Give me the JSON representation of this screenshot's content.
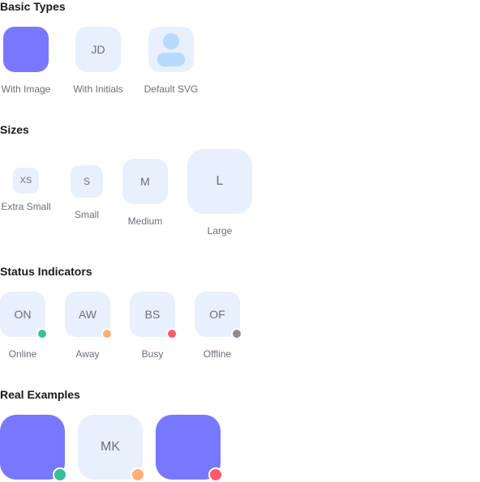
{
  "sections": {
    "basic": {
      "title": "Basic Types",
      "items": [
        {
          "label": "With Image"
        },
        {
          "label": "With Initials",
          "initials": "JD"
        },
        {
          "label": "Default SVG"
        }
      ]
    },
    "sizes": {
      "title": "Sizes",
      "items": [
        {
          "label": "Extra Small",
          "initials": "XS"
        },
        {
          "label": "Small",
          "initials": "S"
        },
        {
          "label": "Medium",
          "initials": "M"
        },
        {
          "label": "Large",
          "initials": "L"
        }
      ]
    },
    "status": {
      "title": "Status Indicators",
      "items": [
        {
          "label": "Online",
          "initials": "ON",
          "status": "online"
        },
        {
          "label": "Away",
          "initials": "AW",
          "status": "away"
        },
        {
          "label": "Busy",
          "initials": "BS",
          "status": "busy"
        },
        {
          "label": "Offline",
          "initials": "OF",
          "status": "offline"
        }
      ]
    },
    "real": {
      "title": "Real Examples",
      "items": [
        {
          "status": "online"
        },
        {
          "initials": "MK",
          "status": "away"
        },
        {
          "status": "busy"
        }
      ]
    }
  },
  "colors": {
    "online": "#34c09a",
    "away": "#fdb07a",
    "busy": "#fe5a6b",
    "offline": "#8a8a90",
    "image": "#7778fe",
    "initials_bg": "#e8effd",
    "default_icon": "#b6dafd"
  }
}
